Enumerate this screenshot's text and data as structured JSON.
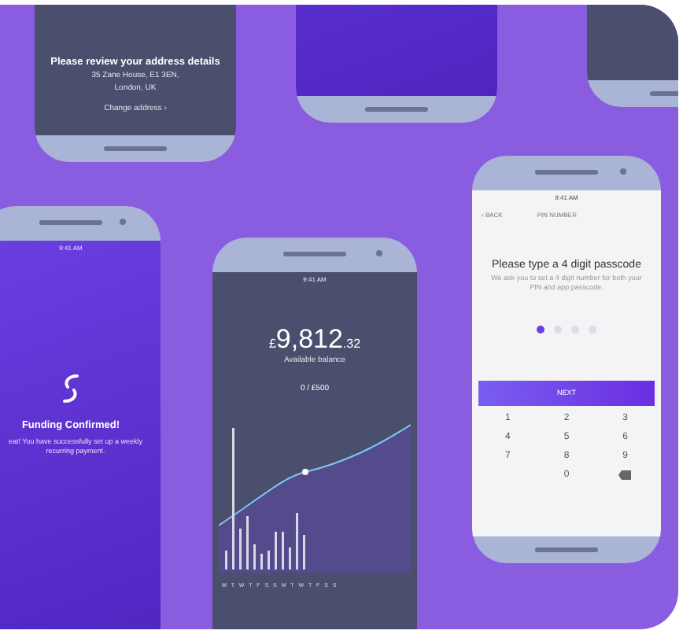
{
  "phones": [
    {
      "kind": "address",
      "title": "Please review your address details",
      "address_lines": [
        "35 Zane House, E1 3EN,",
        "London, UK"
      ],
      "link": "Change address  ›"
    },
    {
      "kind": "blank"
    },
    {
      "kind": "blank_dark"
    },
    {
      "kind": "funding",
      "time": "9:41 AM",
      "title": "Funding Confirmed!",
      "message": "eat! You have successfully set up a weekly recurring payment."
    },
    {
      "kind": "balance",
      "time": "9:41 AM",
      "currency": "£",
      "amount": "9,812",
      "pence": ".32",
      "caption": "Available balance",
      "goal": "0 / £500",
      "days": "M T W T F S S M T W T F S S"
    },
    {
      "kind": "pin",
      "time": "9:41 AM",
      "back": "‹ BACK",
      "screen_title": "PIN NUMBER",
      "title": "Please type a 4 digit passcode",
      "message": "We ask you to set a 4 digit number for both your PIN and app passcode.",
      "dots": [
        {
          "selected": true
        },
        {
          "selected": false
        },
        {
          "selected": false
        },
        {
          "selected": false
        }
      ],
      "button": "NEXT",
      "keys": [
        {
          "kind": "digit",
          "label": "1"
        },
        {
          "kind": "digit",
          "label": "2"
        },
        {
          "kind": "digit",
          "label": "3"
        },
        {
          "kind": "digit",
          "label": "4"
        },
        {
          "kind": "digit",
          "label": "5"
        },
        {
          "kind": "digit",
          "label": "6"
        },
        {
          "kind": "digit",
          "label": "7"
        },
        {
          "kind": "digit",
          "label": "8"
        },
        {
          "kind": "digit",
          "label": "9"
        },
        {
          "kind": "digit",
          "label": "0"
        },
        {
          "kind": "delete"
        }
      ]
    }
  ]
}
